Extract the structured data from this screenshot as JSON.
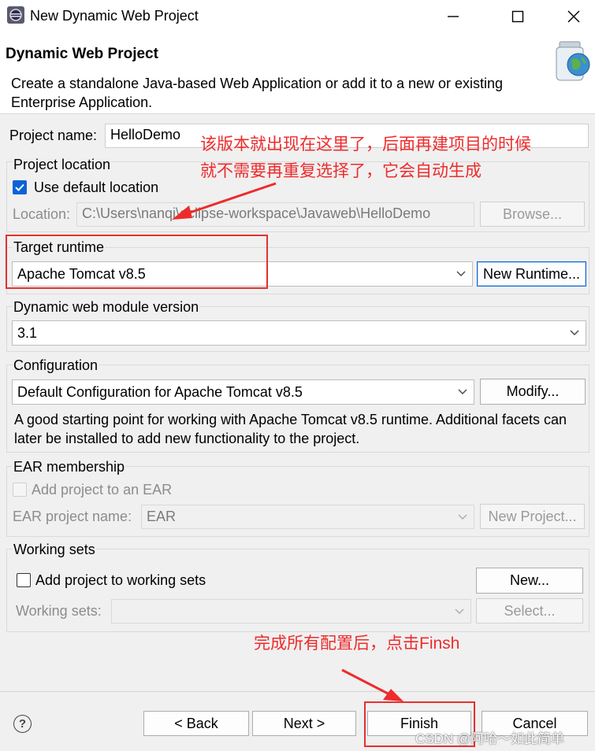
{
  "window": {
    "title": "New Dynamic Web Project"
  },
  "header": {
    "title": "Dynamic Web Project",
    "description": "Create a standalone Java-based Web Application or add it to a new or existing Enterprise Application."
  },
  "project_name": {
    "label": "Project name:",
    "value": "HelloDemo"
  },
  "project_location": {
    "group_label": "Project location",
    "use_default_label": "Use default location",
    "use_default_checked": true,
    "location_label": "Location:",
    "location_value": "C:\\Users\\nanqi\\eclipse-workspace\\Javaweb\\HelloDemo",
    "browse_label": "Browse..."
  },
  "target_runtime": {
    "group_label": "Target runtime",
    "selected": "Apache Tomcat v8.5",
    "new_runtime_label": "New Runtime..."
  },
  "module_version": {
    "group_label": "Dynamic web module version",
    "selected": "3.1"
  },
  "configuration": {
    "group_label": "Configuration",
    "selected": "Default Configuration for Apache Tomcat v8.5",
    "modify_label": "Modify...",
    "description": "A good starting point for working with Apache Tomcat v8.5 runtime. Additional facets can later be installed to add new functionality to the project."
  },
  "ear": {
    "group_label": "EAR membership",
    "add_label": "Add project to an EAR",
    "name_label": "EAR project name:",
    "name_value": "EAR",
    "new_project_label": "New Project..."
  },
  "working_sets": {
    "group_label": "Working sets",
    "add_label": "Add project to working sets",
    "new_label": "New...",
    "sets_label": "Working sets:",
    "select_label": "Select..."
  },
  "footer": {
    "help_icon": "?",
    "back_label": "< Back",
    "next_label": "Next >",
    "finish_label": "Finish",
    "cancel_label": "Cancel"
  },
  "annotations": {
    "note1_line1": "该版本就出现在这里了，后面再建项目的时候",
    "note1_line2": "就不需要再重复选择了，它会自动生成",
    "note2": "完成所有配置后，点击Finsh",
    "watermark": "CSDN @阿哈～如此简单"
  },
  "colors": {
    "accent": "#0a64d6",
    "annotation": "#ee2b2b"
  }
}
